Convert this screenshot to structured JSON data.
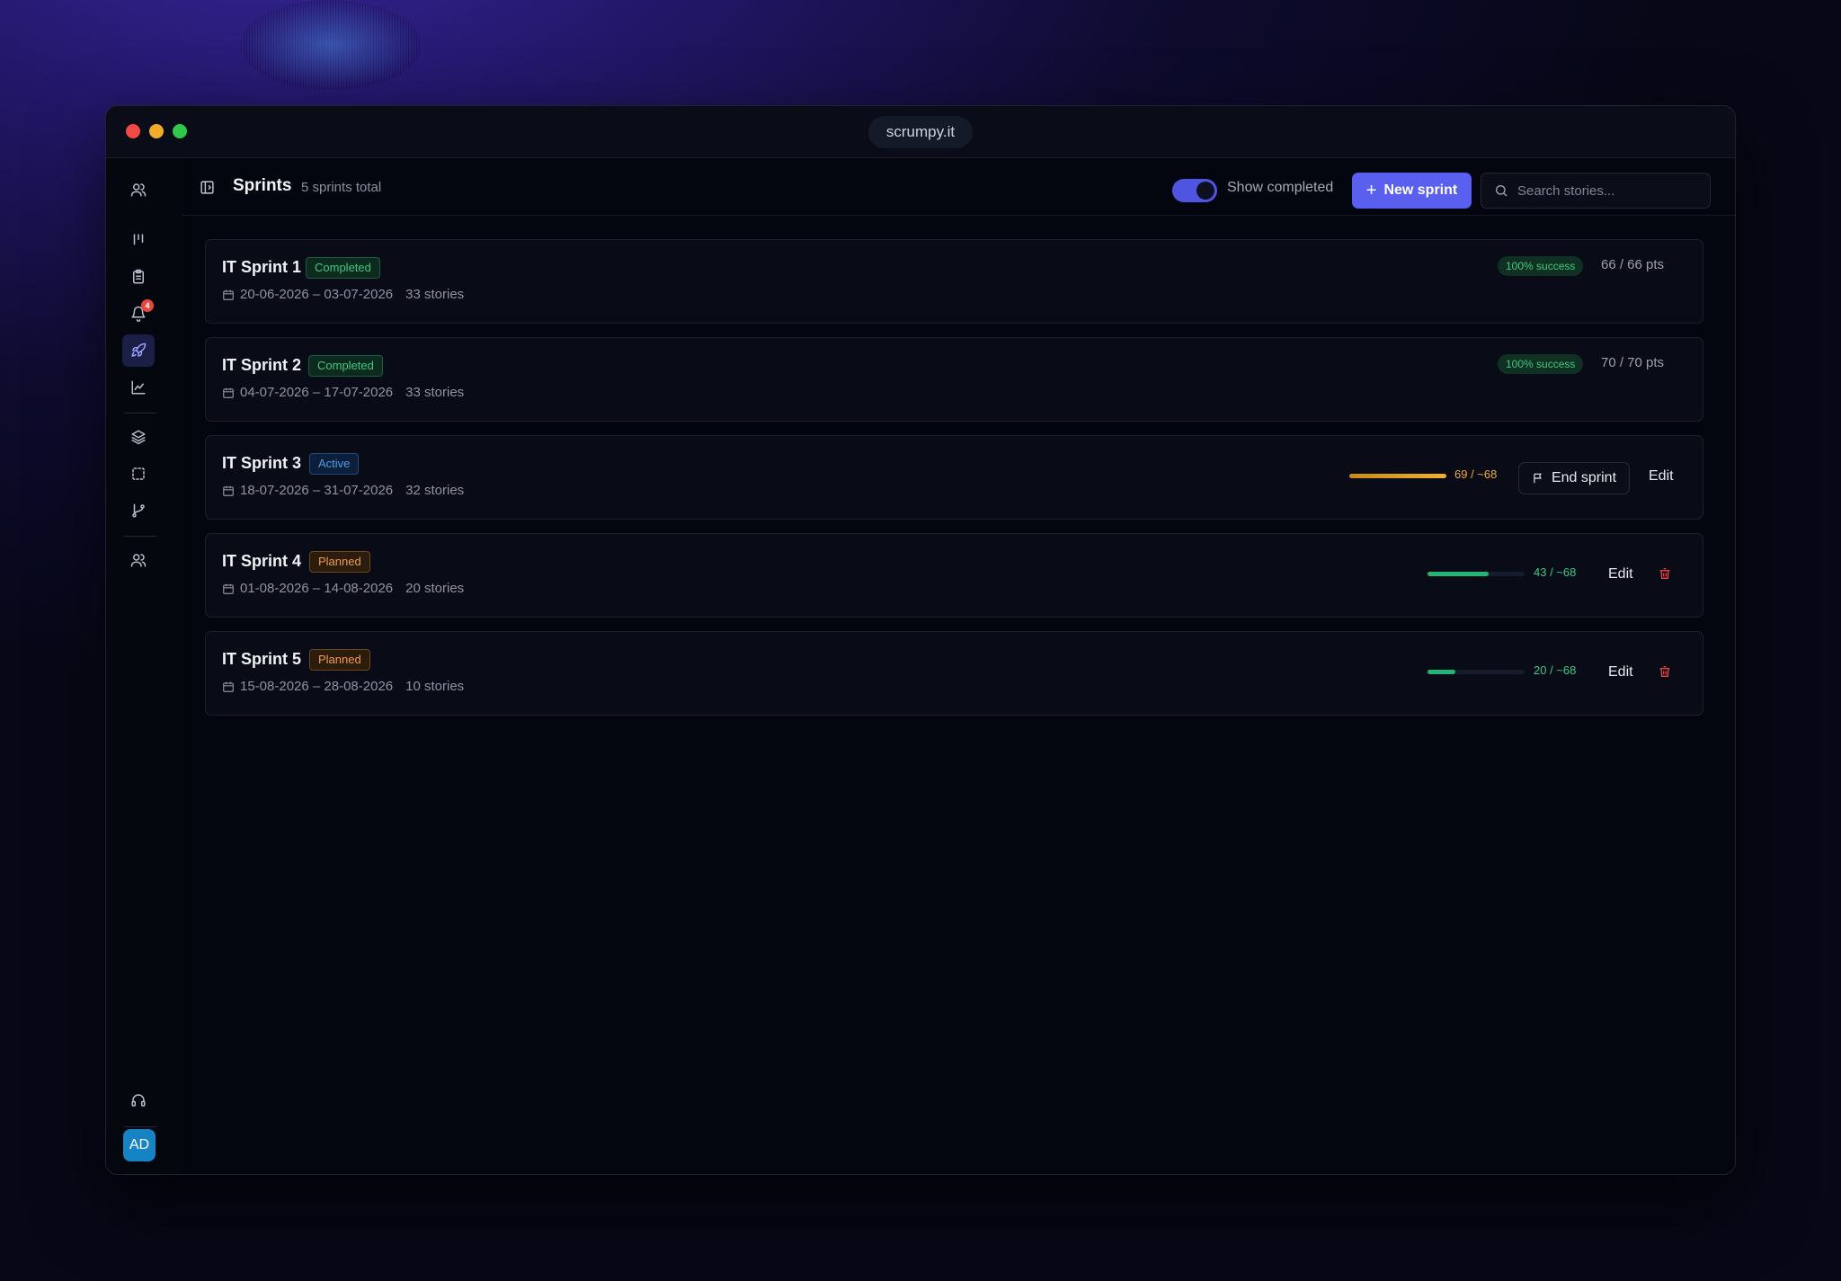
{
  "window": {
    "url": "scrumpy.it"
  },
  "sidebar": {
    "notification_count": "4",
    "avatar_initials": "AD"
  },
  "header": {
    "title": "Sprints",
    "subtitle": "5 sprints total",
    "toggle_label": "Show completed",
    "toggle_on": true,
    "new_sprint_label": "New sprint",
    "search_placeholder": "Search stories..."
  },
  "sprints": [
    {
      "name": "IT Sprint 1",
      "status": "Completed",
      "dates": "20-06-2026 – 03-07-2026",
      "stories": "33 stories",
      "success": "100% success",
      "points": "66 / 66 pts"
    },
    {
      "name": "IT Sprint 2",
      "status": "Completed",
      "dates": "04-07-2026 – 17-07-2026",
      "stories": "33 stories",
      "success": "100% success",
      "points": "70 / 70 pts"
    },
    {
      "name": "IT Sprint 3",
      "status": "Active",
      "dates": "18-07-2026 – 31-07-2026",
      "stories": "32 stories",
      "capacity": "69 / ~68",
      "capacity_fraction": 1.0,
      "end_label": "End sprint",
      "edit_label": "Edit"
    },
    {
      "name": "IT Sprint 4",
      "status": "Planned",
      "dates": "01-08-2026 – 14-08-2026",
      "stories": "20 stories",
      "capacity": "43 / ~68",
      "capacity_fraction": 0.63,
      "edit_label": "Edit"
    },
    {
      "name": "IT Sprint 5",
      "status": "Planned",
      "dates": "15-08-2026 – 28-08-2026",
      "stories": "10 stories",
      "capacity": "20 / ~68",
      "capacity_fraction": 0.29,
      "edit_label": "Edit"
    }
  ],
  "colors": {
    "accent": "#5a5ff0",
    "success": "#3ec983",
    "active": "#4a9ff0",
    "planned": "#f09d4a",
    "over_capacity": "#e8a020",
    "danger": "#e8453c"
  }
}
